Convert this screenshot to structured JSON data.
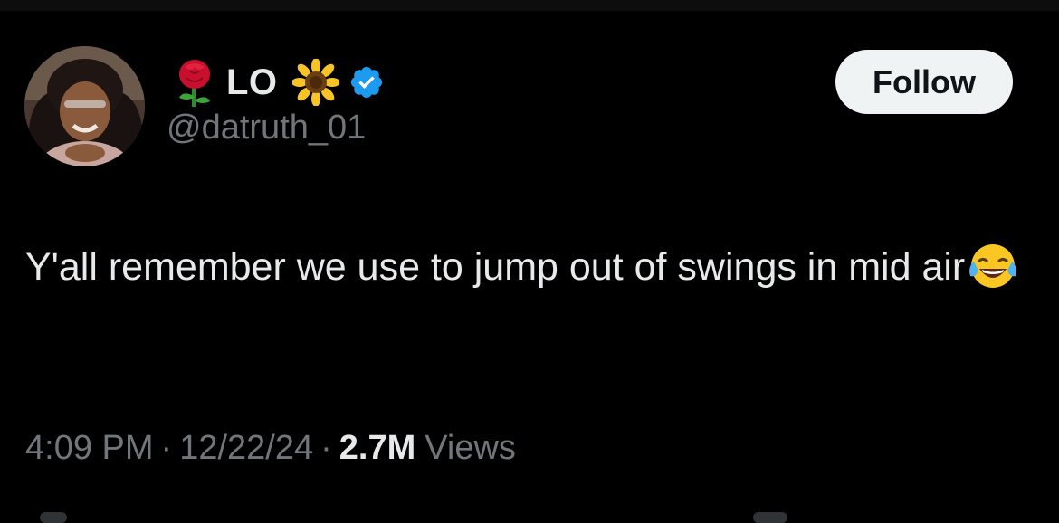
{
  "tweet": {
    "author": {
      "display_name": "LO",
      "handle": "@datruth_01",
      "name_prefix_icon": "rose-icon",
      "name_suffix_icon": "sunflower-icon",
      "badge_icon": "verified-icon",
      "badge_color": "#1d9bf0"
    },
    "follow_label": "Follow",
    "text": "Y'all remember we use to jump out of swings  in mid air",
    "text_emoji_icon": "face-with-tears-of-joy-icon",
    "time": "4:09 PM",
    "separator": "·",
    "date": "12/22/24",
    "views_count": "2.7M",
    "views_label": "Views"
  },
  "colors": {
    "background": "#000000",
    "primary_text": "#e7e9ea",
    "secondary_text": "#71767b",
    "follow_button_bg": "#eff3f4",
    "follow_button_text": "#0f1419"
  }
}
